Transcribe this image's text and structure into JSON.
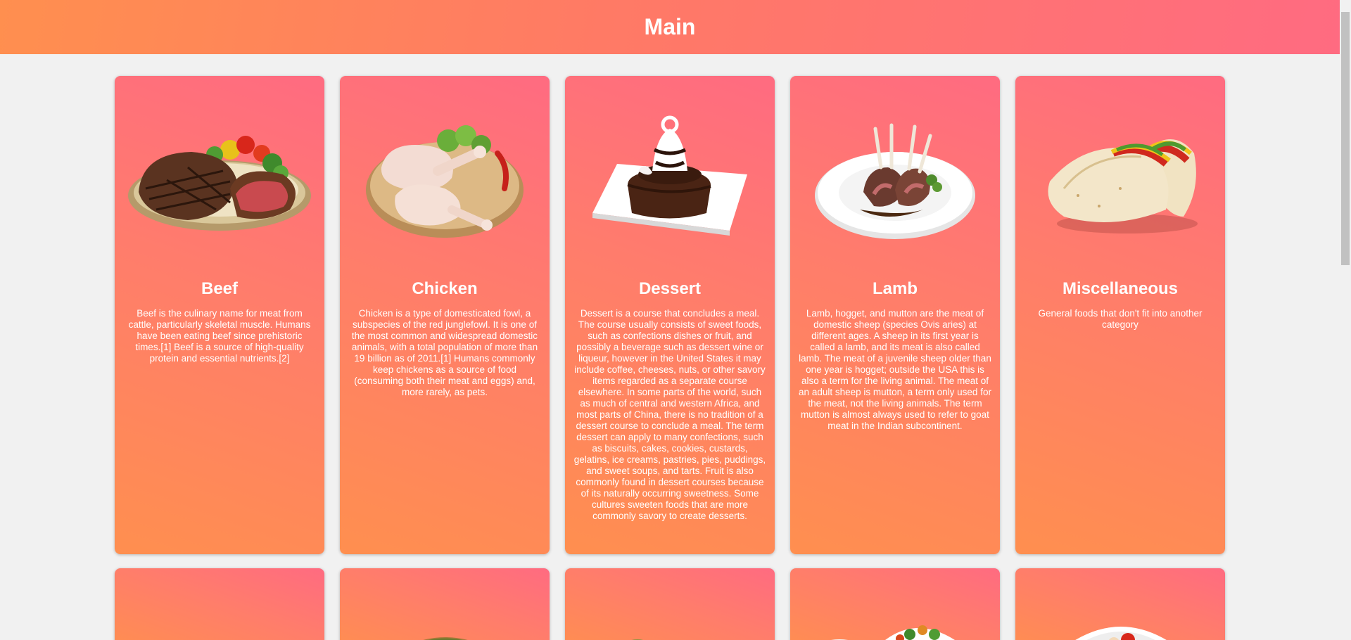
{
  "header": {
    "title": "Main"
  },
  "categories": [
    {
      "name": "Beef",
      "description": "Beef is the culinary name for meat from cattle, particularly skeletal muscle. Humans have been eating beef since prehistoric times.[1] Beef is a source of high-quality protein and essential nutrients.[2]",
      "image_icon": "beef-steak-icon"
    },
    {
      "name": "Chicken",
      "description": "Chicken is a type of domesticated fowl, a subspecies of the red junglefowl. It is one of the most common and widespread domestic animals, with a total population of more than 19 billion as of 2011.[1] Humans commonly keep chickens as a source of food (consuming both their meat and eggs) and, more rarely, as pets.",
      "image_icon": "chicken-legs-icon"
    },
    {
      "name": "Dessert",
      "description": "Dessert is a course that concludes a meal. The course usually consists of sweet foods, such as confections dishes or fruit, and possibly a beverage such as dessert wine or liqueur, however in the United States it may include coffee, cheeses, nuts, or other savory items regarded as a separate course elsewhere. In some parts of the world, such as much of central and western Africa, and most parts of China, there is no tradition of a dessert course to conclude a meal. The term dessert can apply to many confections, such as biscuits, cakes, cookies, custards, gelatins, ice creams, pastries, pies, puddings, and sweet soups, and tarts. Fruit is also commonly found in dessert courses because of its naturally occurring sweetness. Some cultures sweeten foods that are more commonly savory to create desserts.",
      "image_icon": "chocolate-cake-icon"
    },
    {
      "name": "Lamb",
      "description": "Lamb, hogget, and mutton are the meat of domestic sheep (species Ovis aries) at different ages. A sheep in its first year is called a lamb, and its meat is also called lamb. The meat of a juvenile sheep older than one year is hogget; outside the USA this is also a term for the living animal. The meat of an adult sheep is mutton, a term only used for the meat, not the living animals. The term mutton is almost always used to refer to goat meat in the Indian subcontinent.",
      "image_icon": "lamb-chops-icon"
    },
    {
      "name": "Miscellaneous",
      "description": "General foods that don't fit into another category",
      "image_icon": "tacos-icon"
    }
  ],
  "second_row_icons": [
    "food-plate-icon",
    "pie-icon",
    "pasta-dish-icon",
    "vegetable-bowls-icon",
    "salad-plate-icon"
  ]
}
